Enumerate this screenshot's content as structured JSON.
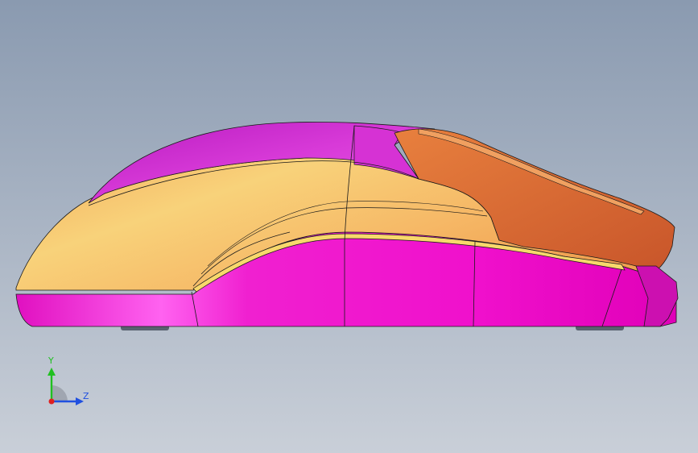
{
  "viewport": {
    "background_top": "#8a9ab0",
    "background_bottom": "#c9cfd8",
    "model": {
      "name": "mouse-model",
      "colors": {
        "top_shell_magenta": "#c21ec4",
        "top_shell_highlight": "#e25ae0",
        "side_band_orange": "#f2a65a",
        "side_band_light": "#f8d27a",
        "button_orange": "#e0743a",
        "button_dark": "#c8552a",
        "base_magenta": "#ea10c8",
        "base_highlight": "#ff62f0",
        "edge_line": "#1a1a1a",
        "foot_gray": "#5a6270"
      }
    }
  },
  "triad": {
    "y_label": "Y",
    "z_label": "Z",
    "y_color": "#20c020",
    "z_color": "#2050e0",
    "x_color": "#e02020"
  }
}
